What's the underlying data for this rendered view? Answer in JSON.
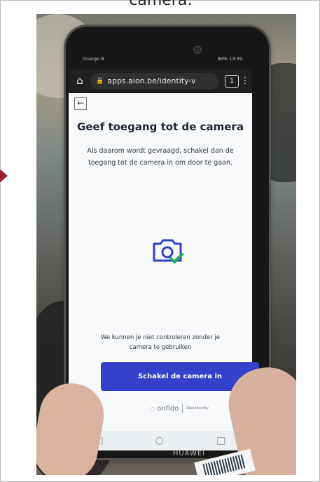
{
  "caption": "camera:",
  "phone": {
    "carrier": "Orange B",
    "status_right": "89%  13:39",
    "brand_label": "HUAWEI"
  },
  "browser": {
    "home_icon": "home-icon",
    "url": "apps.aion.be/identity-v",
    "tabs_count": "1",
    "menu_icon": "more-vert-icon"
  },
  "screen": {
    "back_icon": "back-arrow-icon",
    "title": "Geef toegang tot de camera",
    "description": "Als daarom wordt gevraagd, schakel dan de toegang tot de camera in om door te gaan.",
    "camera_icon": "camera-check-icon",
    "note": "We kunnen je niet controleren zonder je camera te gebruiken",
    "button_label": "Schakel de camera in",
    "footer_brand": "onfido",
    "footer_sub": "Real Identity"
  },
  "navigation": {
    "back": "◁",
    "home": "○",
    "recent": "□"
  },
  "colors": {
    "button": "#3340c9",
    "screen_bg": "#f7f9fb",
    "check": "#22a85a",
    "arrow": "#9b1d35"
  }
}
